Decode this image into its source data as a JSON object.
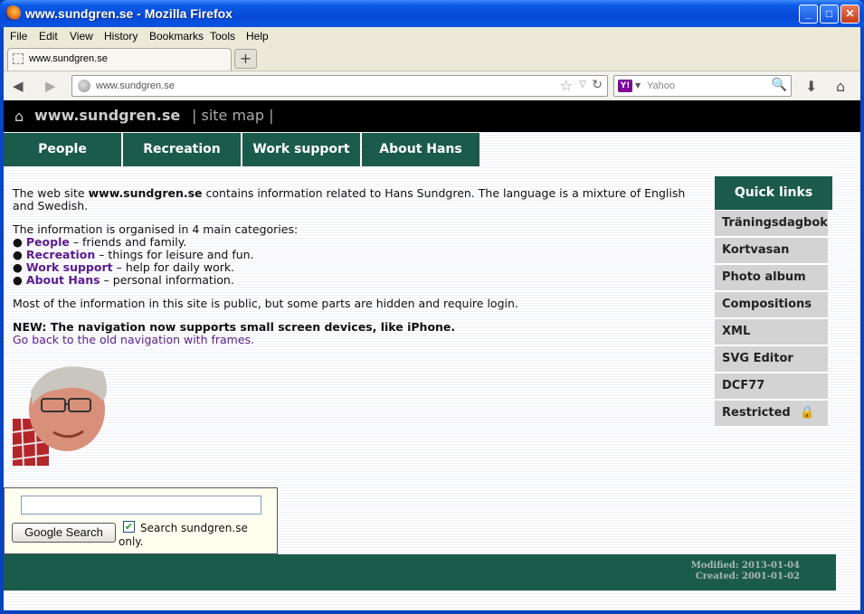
{
  "window": {
    "title": "www.sundgren.se - Mozilla Firefox"
  },
  "menu": [
    "File",
    "Edit",
    "View",
    "History",
    "Bookmarks",
    "Tools",
    "Help"
  ],
  "tab": {
    "title": "www.sundgren.se"
  },
  "address": {
    "url": "www.sundgren.se"
  },
  "search_engine": {
    "placeholder": "Yahoo"
  },
  "site": {
    "brand": "www.sundgren.se",
    "sitemap": "| site map |",
    "nav": [
      "People",
      "Recreation",
      "Work support",
      "About Hans"
    ]
  },
  "content": {
    "intro_pre": "The web site ",
    "intro_bold": "www.sundgren.se",
    "intro_post": " contains information related to Hans Sundgren. The language is a mixture of English and Swedish.",
    "categories_intro": "The information is organised in 4 main categories:",
    "categories": [
      {
        "name": "People",
        "desc": " – friends and family."
      },
      {
        "name": "Recreation",
        "desc": " – things for leisure and fun."
      },
      {
        "name": "Work support",
        "desc": " – help for daily work."
      },
      {
        "name": "About Hans",
        "desc": " – personal information."
      }
    ],
    "public_note": "Most of the information in this site is public, but some parts are hidden and require login.",
    "new_note": "NEW: The navigation now supports small screen devices, like iPhone.",
    "old_nav_link": "Go back to the old navigation with frames."
  },
  "quick_links": {
    "heading": "Quick links",
    "items": [
      "Träningsdagbok",
      "Kortvasan",
      "Photo album",
      "Compositions",
      "XML",
      "SVG Editor",
      "DCF77",
      "Restricted"
    ]
  },
  "google_search": {
    "query": "",
    "button": "Google Search",
    "checkbox_label": "Search sundgren.se only.",
    "checked": true
  },
  "footer": {
    "modified": "Modified: 2013-01-04",
    "created": "Created: 2001-01-02"
  },
  "colors": {
    "accent": "#1b5b4b",
    "link": "#5a1d8e",
    "quicklink_bg": "#d3d3d3"
  }
}
